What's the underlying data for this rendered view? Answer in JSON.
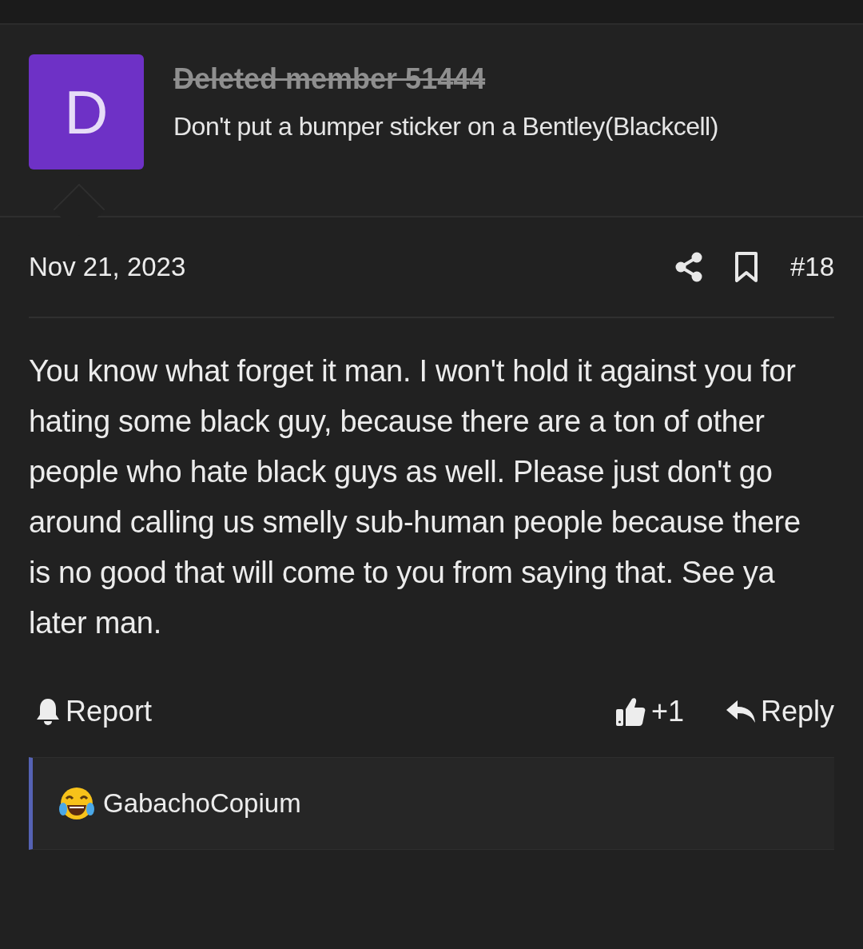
{
  "author": {
    "avatar_letter": "D",
    "name": "Deleted member 51444",
    "deleted": true,
    "signature": "Don't put a bumper sticker on a Bentley(Blackcell)"
  },
  "post": {
    "date": "Nov 21, 2023",
    "number": "#18",
    "body": "You know what forget it man. I won't hold it against you for hating some black guy, because there are a ton of other people who hate black guys as well. Please just don't go around calling us smelly sub-human people because there is no good that will come to you from saying that. See ya later man."
  },
  "actions": {
    "report": "Report",
    "like_count": "+1",
    "reply": "Reply"
  },
  "reactions": [
    {
      "user": "GabachoCopium"
    }
  ]
}
